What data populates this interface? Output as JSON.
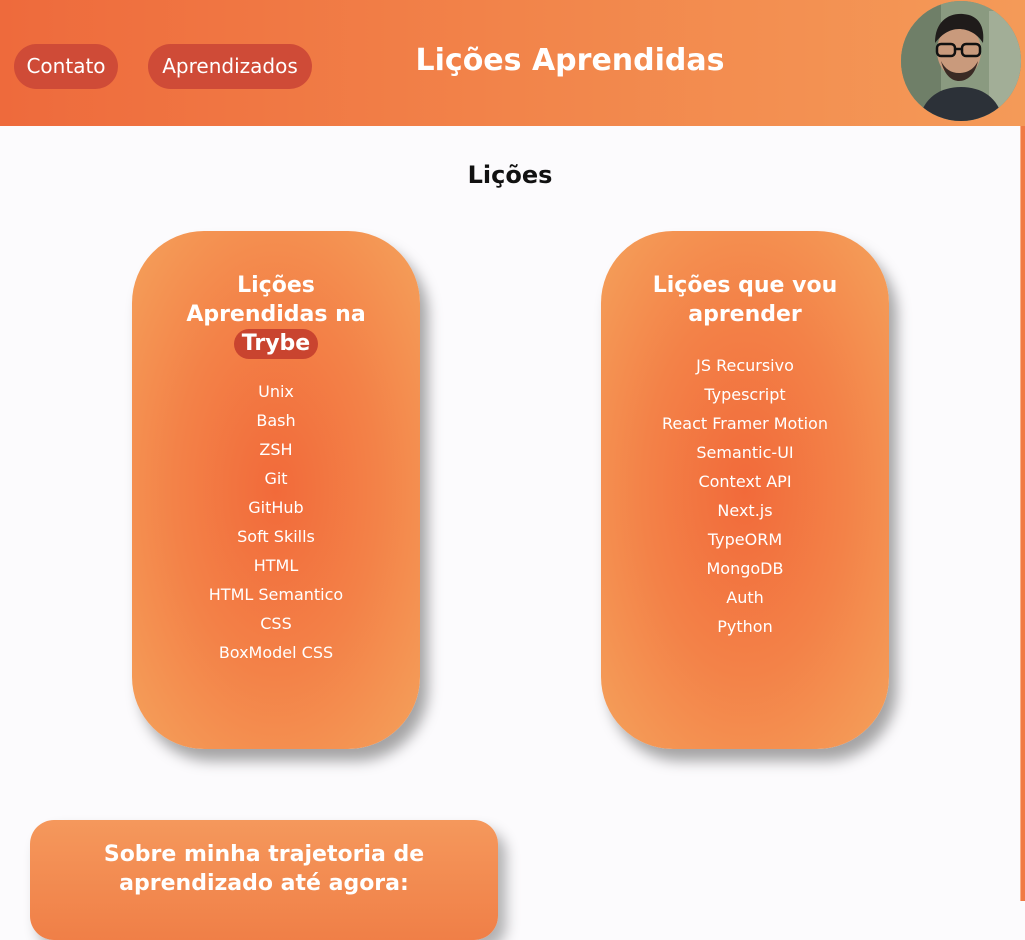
{
  "header": {
    "nav": {
      "contato_label": "Contato",
      "aprendizados_label": "Aprendizados"
    },
    "title": "Lições Aprendidas",
    "avatar_alt": "profile-photo"
  },
  "main": {
    "section_title": "Lições",
    "learned_card": {
      "heading_line1": "Lições",
      "heading_line2": "Aprendidas na",
      "heading_badge": "Trybe",
      "items": [
        "Unix",
        "Bash",
        "ZSH",
        "Git",
        "GitHub",
        "Soft Skills",
        "HTML",
        "HTML Semantico",
        "CSS",
        "BoxModel CSS"
      ]
    },
    "future_card": {
      "heading_line1": "Lições que vou",
      "heading_line2": "aprender",
      "items": [
        "JS Recursivo",
        "Typescript",
        "React Framer Motion",
        "Semantic-UI",
        "Context API",
        "Next.js",
        "TypeORM",
        "MongoDB",
        "Auth",
        "Python"
      ]
    },
    "about_card": {
      "heading_line1": "Sobre minha trajetoria de",
      "heading_line2": "aprendizado até agora:"
    }
  },
  "colors": {
    "header_start": "#ee6a3c",
    "header_end": "#f49a58",
    "nav_button": "#cf4b37",
    "card_center": "#f26a3a",
    "card_edge": "#f5a15b",
    "badge": "#c9442f"
  }
}
